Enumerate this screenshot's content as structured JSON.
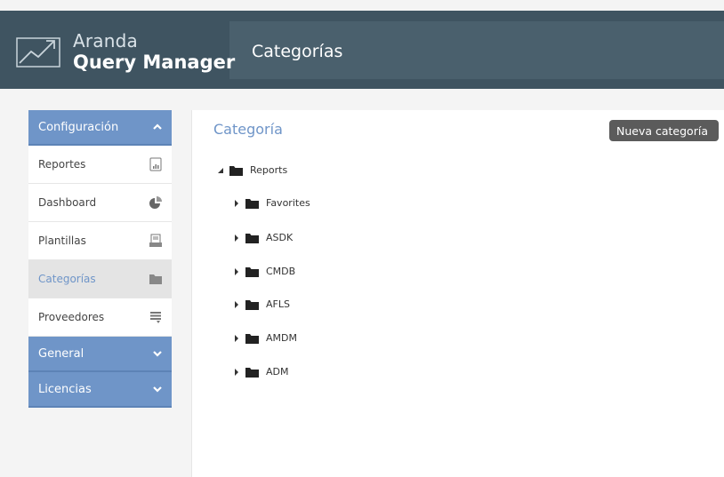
{
  "header": {
    "brand_small": "Aranda",
    "brand_big": "Query Manager",
    "page_title": "Categorías"
  },
  "sidebar": {
    "sections": [
      {
        "label": "Configuración",
        "expanded": true,
        "items": [
          {
            "label": "Reportes",
            "icon": "report-icon"
          },
          {
            "label": "Dashboard",
            "icon": "pie-chart-icon"
          },
          {
            "label": "Plantillas",
            "icon": "template-icon"
          },
          {
            "label": "Categorías",
            "icon": "folder-icon",
            "active": true
          },
          {
            "label": "Proveedores",
            "icon": "provider-icon"
          }
        ]
      },
      {
        "label": "General",
        "expanded": false
      },
      {
        "label": "Licencias",
        "expanded": false
      }
    ]
  },
  "main": {
    "title": "Categoría",
    "new_button": "Nueva categoría",
    "tree": {
      "root": "Reports",
      "children": [
        "Favorites",
        "ASDK",
        "CMDB",
        "AFLS",
        "AMDM",
        "ADM"
      ]
    }
  },
  "colors": {
    "header_bg": "#3f5461",
    "accent": "#6f95c8",
    "active_item_bg": "#e4e4e4",
    "button_bg": "#5b5b5b"
  }
}
